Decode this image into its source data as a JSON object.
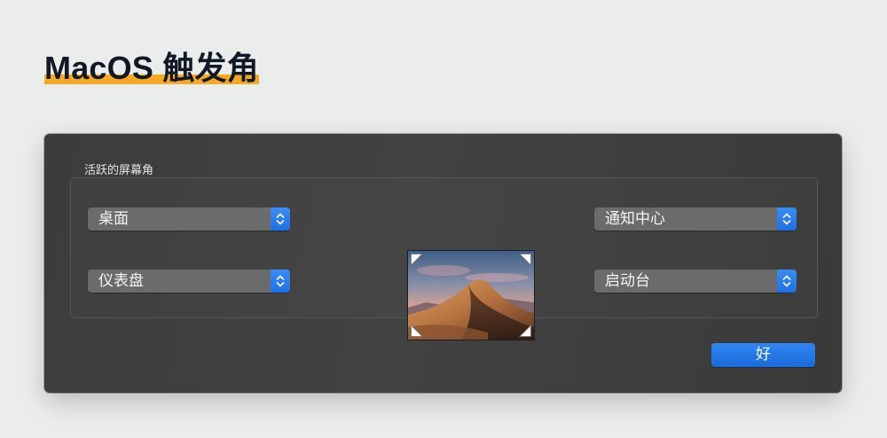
{
  "page": {
    "title": "MacOS 触发角",
    "accent_color": "#f7a823"
  },
  "dialog": {
    "section_label": "活跃的屏幕角",
    "corners": {
      "top_left": "桌面",
      "bottom_left": "仪表盘",
      "top_right": "通知中心",
      "bottom_right": "启动台"
    },
    "ok_label": "好",
    "button_color": "#1f6fe4",
    "preview_image": "macos-mojave-desert-dunes"
  }
}
